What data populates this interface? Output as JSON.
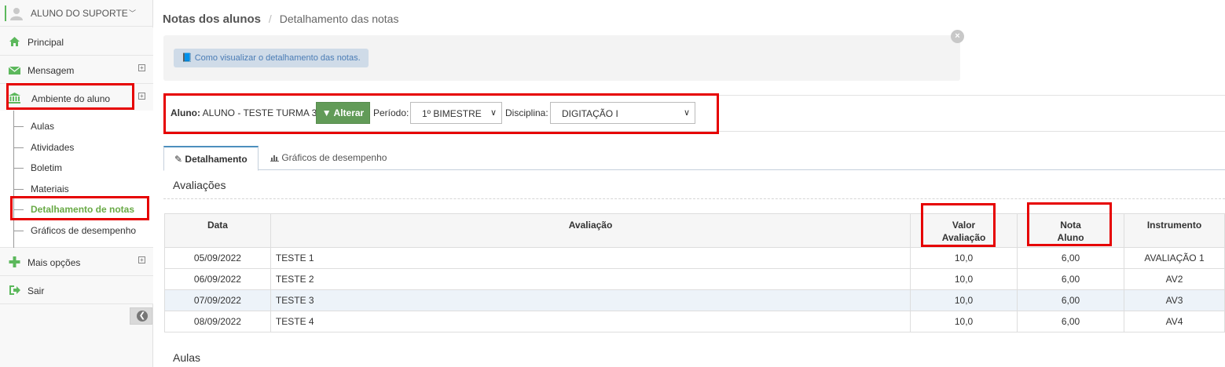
{
  "user": {
    "name": "ALUNO DO SUPORTE",
    "chevron": "﹀"
  },
  "sidebar": {
    "items": [
      {
        "label": "Principal",
        "icon": "home-icon"
      },
      {
        "label": "Mensagem",
        "icon": "envelope-icon",
        "expand": "+"
      },
      {
        "label": "Ambiente do aluno",
        "icon": "bank-icon",
        "expand": "+"
      },
      {
        "label": "Mais opções",
        "icon": "plus-icon",
        "expand": "+"
      },
      {
        "label": "Sair",
        "icon": "exit-icon"
      }
    ],
    "subitems": [
      "Aulas",
      "Atividades",
      "Boletim",
      "Materiais",
      "Detalhamento de notas",
      "Gráficos de desempenho"
    ],
    "collapse_glyph": "❮"
  },
  "breadcrumb": {
    "title": "Notas dos alunos",
    "separator": "/",
    "current": "Detalhamento das notas"
  },
  "info": {
    "button_label": "Como visualizar o detalhamento das notas.",
    "close": "×"
  },
  "filters": {
    "aluno_label": "Aluno:",
    "aluno_value": "ALUNO - TESTE TURMA 3",
    "alterar_label": "Alterar",
    "periodo_label": "Período:",
    "periodo_value": "1º BIMESTRE",
    "disciplina_label": "Disciplina:",
    "disciplina_value": "DIGITAÇÃO I"
  },
  "tabs": [
    {
      "label": "Detalhamento",
      "icon": "edit-icon",
      "active": true
    },
    {
      "label": "Gráficos de desempenho",
      "icon": "bar-chart-icon",
      "active": false
    }
  ],
  "sections": {
    "avaliacoes": "Avaliações",
    "aulas": "Aulas"
  },
  "table": {
    "headers": [
      "Data",
      "Avaliação",
      "Valor Avaliação",
      "Nota Aluno",
      "Instrumento"
    ],
    "rows": [
      [
        "05/09/2022",
        "TESTE 1",
        "10,0",
        "6,00",
        "AVALIAÇÃO 1"
      ],
      [
        "06/09/2022",
        "TESTE 2",
        "10,0",
        "6,00",
        "AV2"
      ],
      [
        "07/09/2022",
        "TESTE 3",
        "10,0",
        "6,00",
        "AV3"
      ],
      [
        "08/09/2022",
        "TESTE 4",
        "10,0",
        "6,00",
        "AV4"
      ]
    ]
  },
  "colors": {
    "accent_green": "#629b58",
    "active_green": "#69aa46",
    "annotation_red": "#e60000",
    "tab_blue": "#4c8fbd"
  }
}
